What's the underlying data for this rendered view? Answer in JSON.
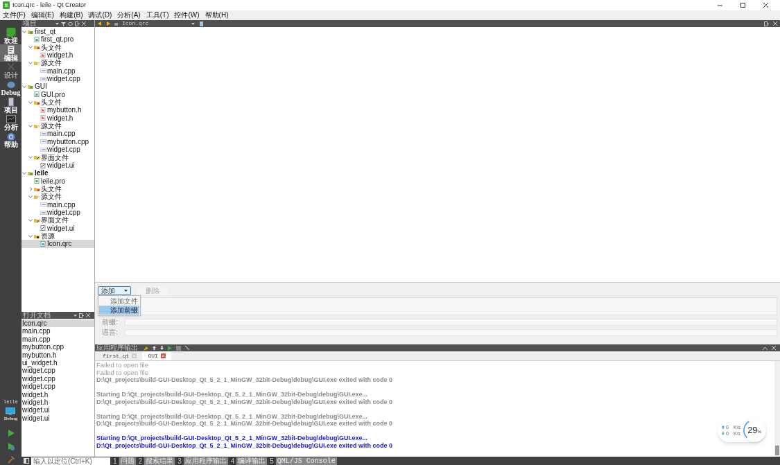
{
  "window": {
    "title": "Icon.qrc - leile - Qt Creator"
  },
  "menu": [
    "文件(F)",
    "编辑(E)",
    "构建(B)",
    "调试(D)",
    "分析(A)",
    "工具(T)",
    "控件(W)",
    "帮助(H)"
  ],
  "modes": [
    {
      "label": "欢迎",
      "kind": "welcome",
      "selected": false,
      "disabled": false
    },
    {
      "label": "编辑",
      "kind": "edit",
      "selected": true,
      "disabled": false
    },
    {
      "label": "设计",
      "kind": "design",
      "selected": false,
      "disabled": true
    },
    {
      "label": "Debug",
      "kind": "debug",
      "selected": false,
      "disabled": false
    },
    {
      "label": "项目",
      "kind": "projects",
      "selected": false,
      "disabled": false
    },
    {
      "label": "分析",
      "kind": "analyze",
      "selected": false,
      "disabled": false
    },
    {
      "label": "帮助",
      "kind": "help",
      "selected": false,
      "disabled": false
    }
  ],
  "kit": {
    "project": "leile",
    "build": "Debug"
  },
  "project_pane": {
    "title": "项目",
    "tree": [
      {
        "label": "first_qt",
        "kind": "project",
        "expanded": true,
        "active": false,
        "selected": false,
        "children": [
          {
            "label": "first_qt.pro",
            "kind": "pro",
            "selected": false
          },
          {
            "label": "头文件",
            "kind": "headers",
            "expanded": true,
            "selected": false,
            "children": [
              {
                "label": "widget.h",
                "kind": "h",
                "selected": false
              }
            ]
          },
          {
            "label": "源文件",
            "kind": "sources",
            "expanded": true,
            "selected": false,
            "children": [
              {
                "label": "main.cpp",
                "kind": "cpp",
                "selected": false
              },
              {
                "label": "widget.cpp",
                "kind": "cpp",
                "selected": false
              }
            ]
          }
        ]
      },
      {
        "label": "GUI",
        "kind": "project",
        "expanded": true,
        "active": false,
        "selected": false,
        "children": [
          {
            "label": "GUI.pro",
            "kind": "pro",
            "selected": false
          },
          {
            "label": "头文件",
            "kind": "headers",
            "expanded": true,
            "selected": false,
            "children": [
              {
                "label": "mybutton.h",
                "kind": "h",
                "selected": false
              },
              {
                "label": "widget.h",
                "kind": "h",
                "selected": false
              }
            ]
          },
          {
            "label": "源文件",
            "kind": "sources",
            "expanded": true,
            "selected": false,
            "children": [
              {
                "label": "main.cpp",
                "kind": "cpp",
                "selected": false
              },
              {
                "label": "mybutton.cpp",
                "kind": "cpp",
                "selected": false
              },
              {
                "label": "widget.cpp",
                "kind": "cpp",
                "selected": false
              }
            ]
          },
          {
            "label": "界面文件",
            "kind": "forms",
            "expanded": true,
            "selected": false,
            "children": [
              {
                "label": "widget.ui",
                "kind": "ui",
                "selected": false
              }
            ]
          }
        ]
      },
      {
        "label": "leile",
        "kind": "project",
        "expanded": true,
        "active": true,
        "selected": false,
        "children": [
          {
            "label": "leile.pro",
            "kind": "pro",
            "selected": false
          },
          {
            "label": "头文件",
            "kind": "headers",
            "expanded": false,
            "selected": false
          },
          {
            "label": "源文件",
            "kind": "sources",
            "expanded": true,
            "selected": false,
            "children": [
              {
                "label": "main.cpp",
                "kind": "cpp",
                "selected": false
              },
              {
                "label": "widget.cpp",
                "kind": "cpp",
                "selected": false
              }
            ]
          },
          {
            "label": "界面文件",
            "kind": "forms",
            "expanded": true,
            "selected": false,
            "children": [
              {
                "label": "widget.ui",
                "kind": "ui",
                "selected": false
              }
            ]
          },
          {
            "label": "资源",
            "kind": "resources",
            "expanded": true,
            "selected": false,
            "children": [
              {
                "label": "Icon.qrc",
                "kind": "qrc",
                "selected": true
              }
            ]
          }
        ]
      }
    ]
  },
  "open_documents": {
    "title": "打开文档",
    "items": [
      {
        "label": "Icon.qrc",
        "selected": true
      },
      {
        "label": "main.cpp",
        "selected": false
      },
      {
        "label": "main.cpp",
        "selected": false
      },
      {
        "label": "mybutton.cpp",
        "selected": false
      },
      {
        "label": "mybutton.h",
        "selected": false
      },
      {
        "label": "ui_widget.h",
        "selected": false
      },
      {
        "label": "widget.cpp",
        "selected": false
      },
      {
        "label": "widget.cpp",
        "selected": false
      },
      {
        "label": "widget.cpp",
        "selected": false
      },
      {
        "label": "widget.h",
        "selected": false
      },
      {
        "label": "widget.h",
        "selected": false
      },
      {
        "label": "widget.ui",
        "selected": false
      },
      {
        "label": "widget.ui",
        "selected": false
      }
    ]
  },
  "editor": {
    "file": "Icon.qrc"
  },
  "resource_editor": {
    "add_button": "添加",
    "remove_button": "删除",
    "remove_disabled": true,
    "menu": [
      {
        "label": "添加文件",
        "selected": false
      },
      {
        "label": "添加前缀",
        "selected": true
      }
    ],
    "fields": [
      {
        "label": "前缀:"
      },
      {
        "label": "语言:"
      }
    ]
  },
  "output_pane": {
    "title": "应用程序输出",
    "tabs": [
      {
        "label": "first_qt",
        "selected": false
      },
      {
        "label": "GUI",
        "selected": true
      }
    ],
    "lines": [
      {
        "text": "Failed to open file",
        "color": "#999999",
        "bold": false
      },
      {
        "text": "Failed to open file",
        "color": "#999999",
        "bold": false
      },
      {
        "text": "D:\\Qt_projects\\build-GUI-Desktop_Qt_5_2_1_MinGW_32bit-Debug\\debug\\GUI.exe exited with code 0",
        "color": "#8c8c8c",
        "bold": true
      },
      {
        "text": "Starting D:\\Qt_projects\\build-GUI-Desktop_Qt_5_2_1_MinGW_32bit-Debug\\debug\\GUI.exe...",
        "color": "#8c8c8c",
        "bold": true,
        "gap_before": true
      },
      {
        "text": "D:\\Qt_projects\\build-GUI-Desktop_Qt_5_2_1_MinGW_32bit-Debug\\debug\\GUI.exe exited with code 0",
        "color": "#8c8c8c",
        "bold": true
      },
      {
        "text": "Starting D:\\Qt_projects\\build-GUI-Desktop_Qt_5_2_1_MinGW_32bit-Debug\\debug\\GUI.exe...",
        "color": "#8c8c8c",
        "bold": true,
        "gap_before": true
      },
      {
        "text": "D:\\Qt_projects\\build-GUI-Desktop_Qt_5_2_1_MinGW_32bit-Debug\\debug\\GUI.exe exited with code 0",
        "color": "#8c8c8c",
        "bold": true
      },
      {
        "text": "Starting D:\\Qt_projects\\build-GUI-Desktop_Qt_5_2_1_MinGW_32bit-Debug\\debug\\GUI.exe...",
        "color": "#1a1ad0",
        "bold": true,
        "gap_before": true
      },
      {
        "text": "D:\\Qt_projects\\build-GUI-Desktop_Qt_5_2_1_MinGW_32bit-Debug\\debug\\GUI.exe exited with code 0",
        "color": "#1a1ad0",
        "bold": true
      }
    ]
  },
  "status_bar": {
    "locator_placeholder": "输入以定位(Ctrl+K)",
    "tabs": [
      {
        "number": "1",
        "label": "问题"
      },
      {
        "number": "2",
        "label": "搜索结果"
      },
      {
        "number": "3",
        "label": "应用程序输出"
      },
      {
        "number": "4",
        "label": "编译输出"
      },
      {
        "number": "5",
        "label": "QML/JS Console"
      }
    ]
  },
  "net_widget": {
    "upload": "0",
    "download": "0",
    "unit_up": "K/s",
    "unit_down": "K/s",
    "percent": "29",
    "percent_sign": "%",
    "level": 0.29
  }
}
